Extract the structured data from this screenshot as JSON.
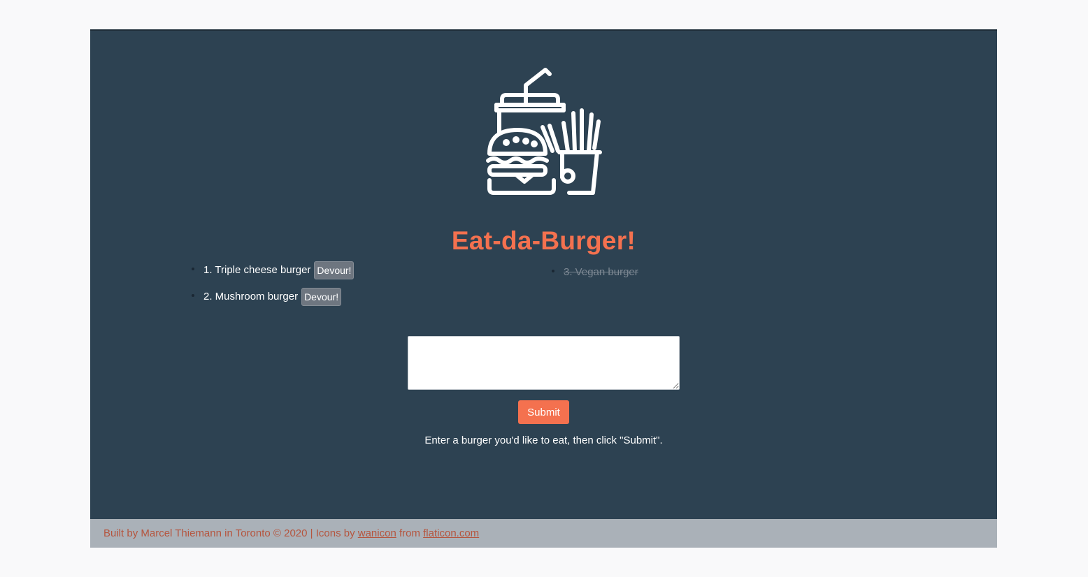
{
  "header": {
    "logo_icon": "fast-food-icon",
    "title": "Eat-da-Burger!"
  },
  "burgers_to_eat": [
    {
      "label": "1. Triple cheese burger",
      "action": "Devour!"
    },
    {
      "label": "2. Mushroom burger",
      "action": "Devour!"
    }
  ],
  "burgers_devoured": [
    {
      "label": "3. Vegan burger"
    }
  ],
  "form": {
    "input_value": "",
    "submit_label": "Submit",
    "help_text": "Enter a burger you'd like to eat, then click \"Submit\"."
  },
  "footer": {
    "prefix": "Built by Marcel Thiemann in Toronto © 2020 | Icons by ",
    "link1": "wanicon",
    "middle": " from ",
    "link2": "flaticon.com"
  },
  "colors": {
    "background": "#2d4252",
    "accent": "#f4714f",
    "footer_bg": "#aab1b8",
    "footer_text": "#b5553e",
    "button_gray": "#6e7680"
  }
}
